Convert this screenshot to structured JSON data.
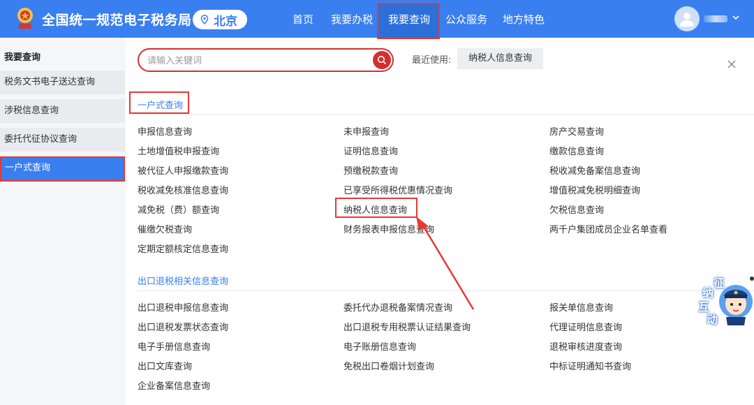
{
  "header": {
    "site_title": "全国统一规范电子税务局",
    "region": "北京",
    "nav": [
      "首页",
      "我要办税",
      "我要查询",
      "公众服务",
      "地方特色"
    ],
    "active_nav": "我要查询"
  },
  "sidebar": {
    "title": "我要查询",
    "items": [
      "税务文书电子送达查询",
      "涉税信息查询",
      "委托代征协议查询",
      "一户式查询"
    ],
    "active_item": "一户式查询"
  },
  "search": {
    "placeholder": "请输入关键词",
    "recent_label": "最近使用:",
    "recent_item": "纳税人信息查询"
  },
  "sections": [
    {
      "title": "一户式查询",
      "items": [
        "申报信息查询",
        "未申报查询",
        "房产交易查询",
        "土地增值税申报查询",
        "证明信息查询",
        "缴款信息查询",
        "被代征人申报缴款查询",
        "预缴税款查询",
        "税收减免备案信息查询",
        "税收减免核准信息查询",
        "已享受所得税优惠情况查询",
        "增值税减免税明细查询",
        "减免税（费）额查询",
        "纳税人信息查询",
        "欠税信息查询",
        "催缴欠税查询",
        "财务报表申报信息查询",
        "两千户集团成员企业名单查看",
        "定期定额核定信息查询"
      ]
    },
    {
      "title": "出口退税相关信息查询",
      "items": [
        "出口退税申报信息查询",
        "委托代办退税备案情况查询",
        "报关单信息查询",
        "出口退税发票状态查询",
        "出口退税专用税票认证结果查询",
        "代理证明信息查询",
        "电子手册信息查询",
        "电子账册信息查询",
        "退税审核进度查询",
        "出口文库查询",
        "免税出口卷烟计划查询",
        "中标证明通知书查询",
        "企业备案信息查询"
      ]
    }
  ],
  "mascot": {
    "chars": [
      "征",
      "纳",
      "互",
      "动"
    ]
  },
  "colors": {
    "primary": "#3a7ff0",
    "highlight": "#e53935"
  }
}
